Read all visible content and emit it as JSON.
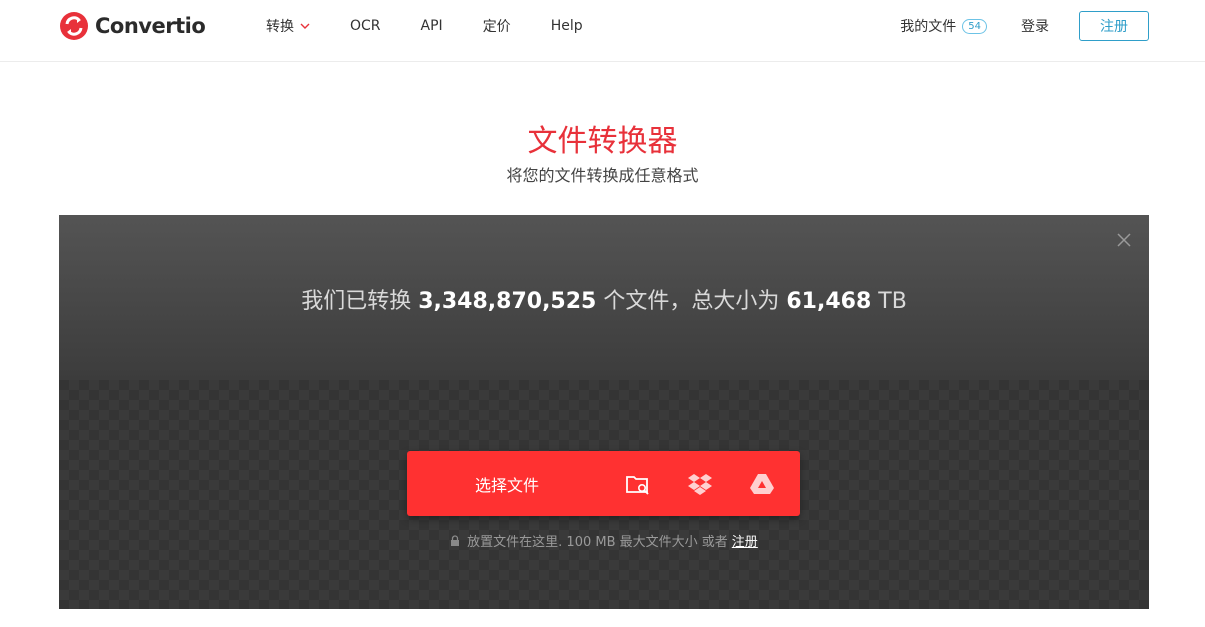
{
  "brand": {
    "name": "Convertio",
    "color": "#e8313a"
  },
  "nav": {
    "items": [
      {
        "label": "转换",
        "has_dropdown": true
      },
      {
        "label": "OCR"
      },
      {
        "label": "API"
      },
      {
        "label": "定价"
      },
      {
        "label": "Help"
      }
    ]
  },
  "account": {
    "my_files_label": "我的文件",
    "my_files_count": "54",
    "login_label": "登录",
    "register_label": "注册"
  },
  "hero": {
    "title": "文件转换器",
    "subtitle": "将您的文件转换成任意格式"
  },
  "stats": {
    "prefix": "我们已转换",
    "files_count": "3,348,870,525",
    "middle": "个文件，总大小为",
    "total_size": "61,468",
    "unit": "TB"
  },
  "upload": {
    "choose_label": "选择文件",
    "sources": [
      "folder-search-icon",
      "dropbox-icon",
      "google-drive-icon"
    ],
    "hint_text": "放置文件在这里. 100 MB 最大文件大小 或者",
    "hint_link": "注册"
  },
  "colors": {
    "accent_red": "#ff3131",
    "link_blue": "#2f9ec9"
  }
}
